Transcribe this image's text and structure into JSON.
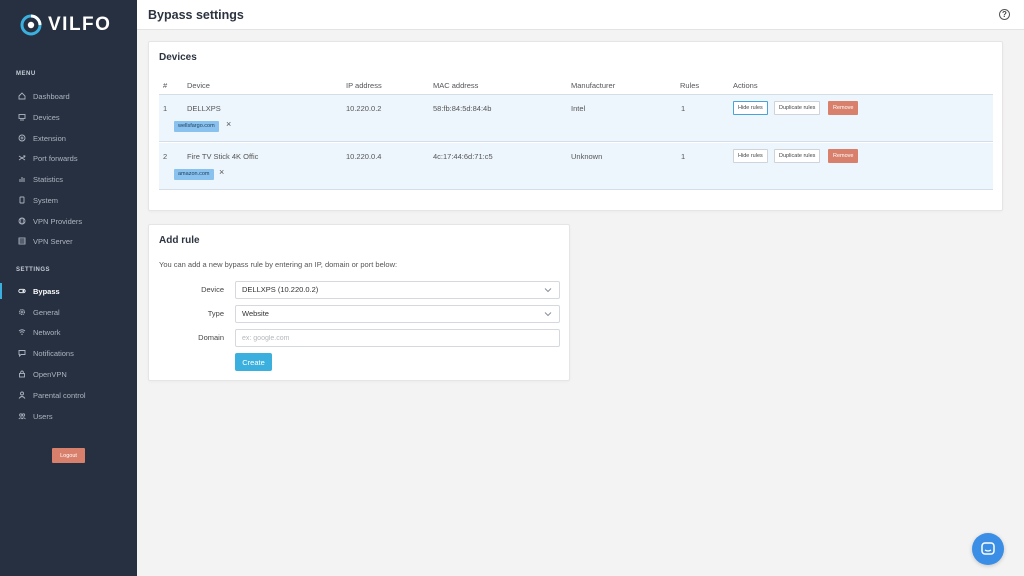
{
  "brand": {
    "name": "VILFO"
  },
  "sidebar": {
    "menu_title": "MENU",
    "menu_items": [
      {
        "label": "Dashboard",
        "icon": "dashboard-icon"
      },
      {
        "label": "Devices",
        "icon": "devices-icon"
      },
      {
        "label": "Extension",
        "icon": "extension-icon"
      },
      {
        "label": "Port forwards",
        "icon": "port-forwards-icon"
      },
      {
        "label": "Statistics",
        "icon": "statistics-icon"
      },
      {
        "label": "System",
        "icon": "system-icon"
      },
      {
        "label": "VPN Providers",
        "icon": "vpn-providers-icon"
      },
      {
        "label": "VPN Server",
        "icon": "vpn-server-icon"
      }
    ],
    "settings_title": "SETTINGS",
    "settings_items": [
      {
        "label": "Bypass",
        "icon": "bypass-icon",
        "active": true
      },
      {
        "label": "General",
        "icon": "general-icon"
      },
      {
        "label": "Network",
        "icon": "network-icon"
      },
      {
        "label": "Notifications",
        "icon": "notifications-icon"
      },
      {
        "label": "OpenVPN",
        "icon": "openvpn-icon"
      },
      {
        "label": "Parental control",
        "icon": "parental-control-icon"
      },
      {
        "label": "Users",
        "icon": "users-icon"
      }
    ],
    "logout_label": "Logout"
  },
  "header": {
    "title": "Bypass settings",
    "help_icon": "?"
  },
  "devices": {
    "title": "Devices",
    "columns": [
      "#",
      "Device",
      "IP address",
      "MAC address",
      "Manufacturer",
      "Rules",
      "Actions"
    ],
    "rows": [
      {
        "num": "1",
        "device": "DELLXPS",
        "ip": "10.220.0.2",
        "mac": "58:fb:84:5d:84:4b",
        "manufacturer": "Intel",
        "rules": "1",
        "tag": "wellsfargo.com",
        "tag_remove": "×"
      },
      {
        "num": "2",
        "device": "Fire TV Stick 4K Offic",
        "ip": "10.220.0.4",
        "mac": "4c:17:44:6d:71:c5",
        "manufacturer": "Unknown",
        "rules": "1",
        "tag": "amazon.com",
        "tag_remove": "×"
      }
    ],
    "actions": {
      "hide": "Hide rules",
      "duplicate": "Duplicate rules",
      "remove": "Remove"
    }
  },
  "add_rule": {
    "title": "Add rule",
    "description": "You can add a new bypass rule by entering an IP, domain or port below:",
    "device_label": "Device",
    "device_value": "DELLXPS (10.220.0.2)",
    "type_label": "Type",
    "type_value": "Website",
    "domain_label": "Domain",
    "domain_placeholder": "ex: google.com",
    "domain_value": "",
    "create_label": "Create"
  },
  "colors": {
    "sidebar_bg": "#263040",
    "accent": "#3bb0de",
    "danger": "#d9806d",
    "tag": "#89c2ef",
    "row_bg": "#eef6fd",
    "chat": "#3b8ee5"
  }
}
